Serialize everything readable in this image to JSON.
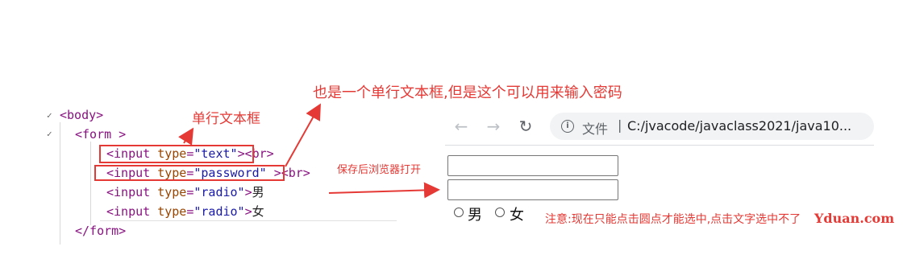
{
  "code": {
    "body_tag": "<body>",
    "form_open": "<form >",
    "lines": [
      {
        "open": "<input ",
        "attr": "type",
        "eq": "=",
        "value": "\"text\"",
        "close": ">",
        "after": "<br>"
      },
      {
        "open": "<input ",
        "attr": "type",
        "eq": "=",
        "value": "\"password\"",
        "close": ">",
        "after": "<br>"
      },
      {
        "open": "<input ",
        "attr": "type",
        "eq": "=",
        "value": "\"radio\"",
        "close": ">",
        "after": "男"
      },
      {
        "open": "<input ",
        "attr": "type",
        "eq": "=",
        "value": "\"radio\"",
        "close": ">",
        "after": "女"
      }
    ],
    "form_close": "</form>"
  },
  "annotations": {
    "single_line": "单行文本框",
    "password": "也是一个单行文本框,但是这个可以用来输入密码",
    "save_open": "保存后浏览器打开",
    "note": "注意:现在只能点击圆点才能选中,点击文字选中不了",
    "watermark": "Yduan.com"
  },
  "browser": {
    "back_icon": "arrow-left",
    "forward_icon": "arrow-right",
    "reload_icon": "reload",
    "info_icon": "info",
    "url_label": "文件",
    "url_separator": "|",
    "url": "C:/jvacode/javaclass2021/java10..."
  },
  "form": {
    "radio_labels": [
      "男",
      "女"
    ]
  },
  "colors": {
    "annotation_red": "#e53935",
    "tag": "#881280",
    "attr": "#994500",
    "value": "#1a1aa6"
  }
}
